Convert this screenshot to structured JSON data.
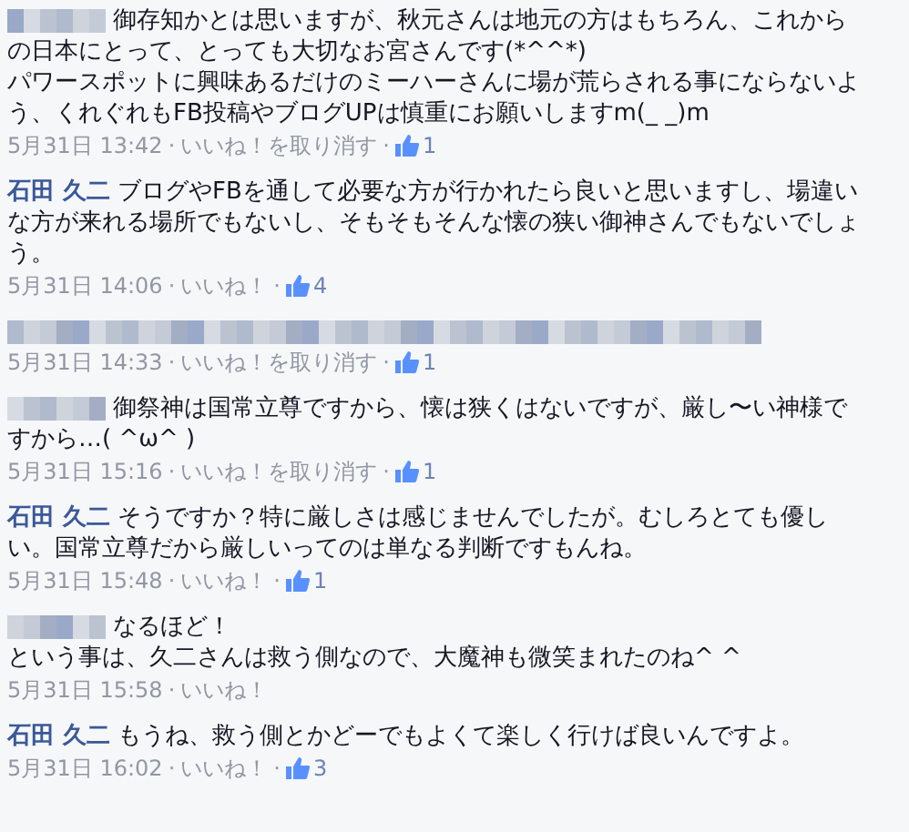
{
  "comments": [
    {
      "kind": "blurred",
      "lines": [
        "御存知かとは思いますが、秋元さんは地元の方はもちろん、これから",
        "の日本にとって、とっても大切なお宮さんです(*^^*)",
        "パワースポットに興味あるだけのミーハーさんに場が荒らされる事にならないよ",
        "う、くれぐれもFB投稿やブログUPは慎重にお願いしますm(_ _)m"
      ],
      "time": "5月31日 13:42",
      "separator": "·",
      "like_link": "いいね！を取り消す",
      "likes": "1"
    },
    {
      "kind": "named",
      "author": "石田 久二",
      "lines": [
        "ブログやFBを通して必要な方が行かれたら良いと思いますし、場違い",
        "な方が来れる場所でもないし、そもそもそんな懐の狭い御神さんでもないでしょ",
        "う。"
      ],
      "time": "5月31日 14:06",
      "separator": "·",
      "like_link": "いいね！",
      "likes": "4"
    },
    {
      "kind": "fully_blurred",
      "time": "5月31日 14:33",
      "separator": "·",
      "like_link": "いいね！を取り消す",
      "likes": "1"
    },
    {
      "kind": "blurred",
      "lines": [
        "御祭神は国常立尊ですから、懐は狭くはないですが、厳し〜い神様で",
        "すから…( ^ω^ )"
      ],
      "time": "5月31日 15:16",
      "separator": "·",
      "like_link": "いいね！を取り消す",
      "likes": "1"
    },
    {
      "kind": "named",
      "author": "石田 久二",
      "lines": [
        "そうですか？特に厳しさは感じませんでしたが。むしろとても優し",
        "い。国常立尊だから厳しいってのは単なる判断ですもんね。"
      ],
      "time": "5月31日 15:48",
      "separator": "·",
      "like_link": "いいね！",
      "likes": "1"
    },
    {
      "kind": "blurred",
      "lines": [
        "なるほど！",
        "という事は、久二さんは救う側なので、大魔神も微笑まれたのね^ ^"
      ],
      "time": "5月31日 15:58",
      "separator": "·",
      "like_link": "いいね！"
    },
    {
      "kind": "named",
      "author": "石田 久二",
      "lines": [
        "もうね、救う側とかどーでもよくて楽しく行けば良いんですよ。"
      ],
      "time": "5月31日 16:02",
      "separator": "·",
      "like_link": "いいね！",
      "likes": "3"
    }
  ]
}
